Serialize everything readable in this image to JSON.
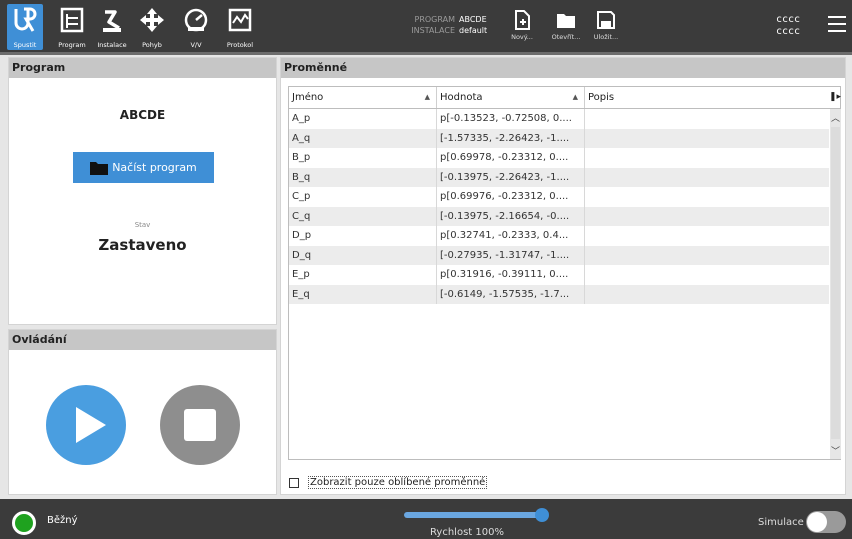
{
  "nav": {
    "run": "Spustit",
    "program": "Program",
    "install": "Instalace",
    "move": "Pohyb",
    "io": "V/V",
    "log": "Protokol"
  },
  "program_info": {
    "program_key": "PROGRAM",
    "program_value": "ABCDE",
    "install_key": "INSTALACE",
    "install_value": "default"
  },
  "file_buttons": {
    "new": "Nový...",
    "open": "Otevřít...",
    "save": "Uložit..."
  },
  "user": {
    "line1": "cccc",
    "line2": "cccc"
  },
  "program_panel": {
    "title": "Program",
    "program_name": "ABCDE",
    "load_button": "Načíst program",
    "state_label": "Stav",
    "state_value": "Zastaveno"
  },
  "control_panel": {
    "title": "Ovládání"
  },
  "variables": {
    "title": "Proměnné",
    "columns": {
      "name": "Jméno",
      "value": "Hodnota",
      "description": "Popis"
    },
    "rows": [
      {
        "name": "A_p",
        "value": "p[-0.13523, -0.72508, 0....",
        "description": ""
      },
      {
        "name": "A_q",
        "value": "[-1.57335, -2.26423, -1....",
        "description": ""
      },
      {
        "name": "B_p",
        "value": "p[0.69978, -0.23312, 0....",
        "description": ""
      },
      {
        "name": "B_q",
        "value": "[-0.13975, -2.26423, -1....",
        "description": ""
      },
      {
        "name": "C_p",
        "value": "p[0.69976, -0.23312, 0....",
        "description": ""
      },
      {
        "name": "C_q",
        "value": "[-0.13975, -2.16654, -0....",
        "description": ""
      },
      {
        "name": "D_p",
        "value": "p[0.32741, -0.2333, 0.4...",
        "description": ""
      },
      {
        "name": "D_q",
        "value": "[-0.27935, -1.31747, -1....",
        "description": ""
      },
      {
        "name": "E_p",
        "value": "p[0.31916, -0.39111, 0....",
        "description": ""
      },
      {
        "name": "E_q",
        "value": "[-0.6149, -1.57535, -1.7...",
        "description": ""
      }
    ],
    "favorites_only": "Zobrazit pouze oblíbené proměnné",
    "favorites_checked": false
  },
  "footer": {
    "mode": "Běžný",
    "speed_label": "Rychlost 100%",
    "speed_fraction": 1.0,
    "simulation_label": "Simulace",
    "simulation_on": false
  },
  "colors": {
    "accent": "#3f8fd6",
    "bar": "#3b3b3b",
    "mode_led": "#1fa21f"
  }
}
